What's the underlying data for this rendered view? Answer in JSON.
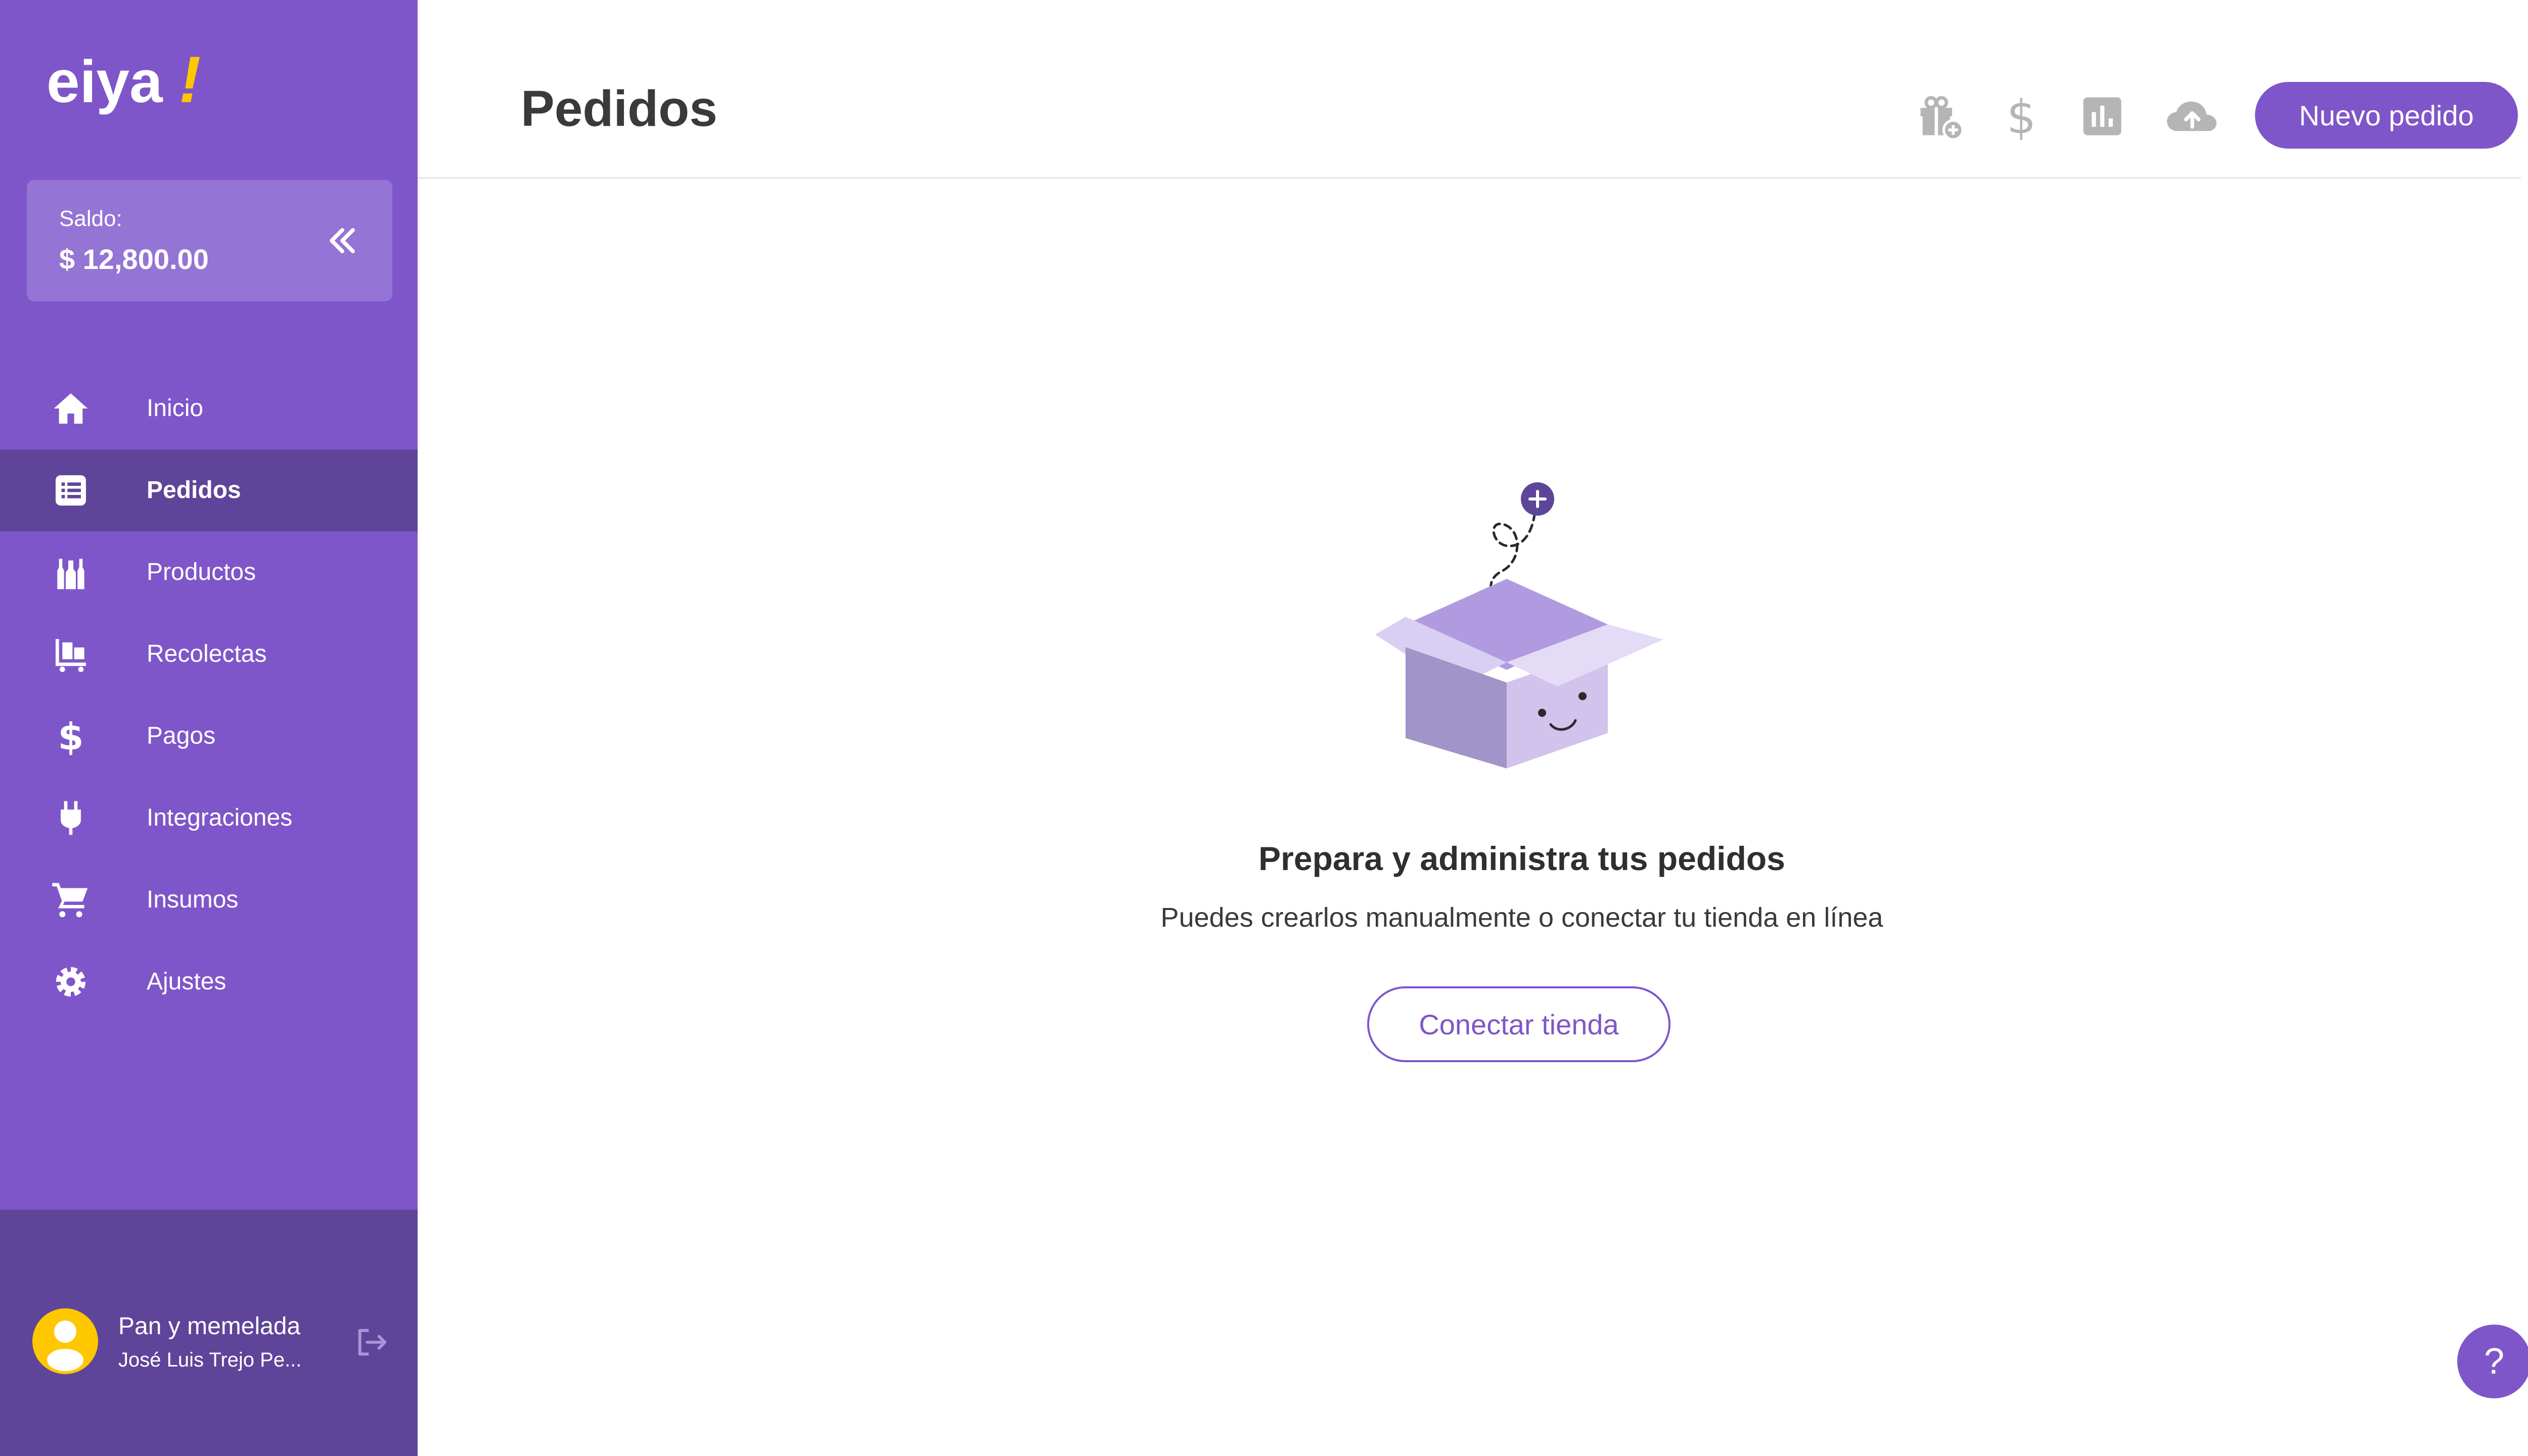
{
  "brand": {
    "logo_text": "eiya",
    "logo_mark": "!",
    "primary_color": "#7f56c9",
    "dark_color": "#5f4599",
    "accent_color": "#ffc700"
  },
  "balance": {
    "label": "Saldo:",
    "amount": "$ 12,800.00",
    "collapse_icon": "double-chevron-left-icon"
  },
  "nav": {
    "items": [
      {
        "label": "Inicio",
        "icon": "home-icon",
        "active": false
      },
      {
        "label": "Pedidos",
        "icon": "list-icon",
        "active": true
      },
      {
        "label": "Productos",
        "icon": "bottles-icon",
        "active": false
      },
      {
        "label": "Recolectas",
        "icon": "dolly-icon",
        "active": false
      },
      {
        "label": "Pagos",
        "icon": "dollar-icon",
        "active": false
      },
      {
        "label": "Integraciones",
        "icon": "plug-icon",
        "active": false
      },
      {
        "label": "Insumos",
        "icon": "cart-icon",
        "active": false
      },
      {
        "label": "Ajustes",
        "icon": "gear-icon",
        "active": false
      }
    ]
  },
  "user": {
    "name": "Pan y memelada",
    "subtitle": "José Luis Trejo Pe...",
    "logout_icon": "logout-icon"
  },
  "header": {
    "title": "Pedidos",
    "tools": [
      "gift-add-icon",
      "dollar-icon",
      "bar-chart-icon",
      "cloud-upload-icon"
    ],
    "new_order_label": "Nuevo pedido"
  },
  "empty_state": {
    "title": "Prepara y administra tus pedidos",
    "subtitle": "Puedes crearlos manualmente o conectar tu tienda en línea",
    "button_label": "Conectar tienda"
  },
  "help": {
    "label": "?"
  }
}
